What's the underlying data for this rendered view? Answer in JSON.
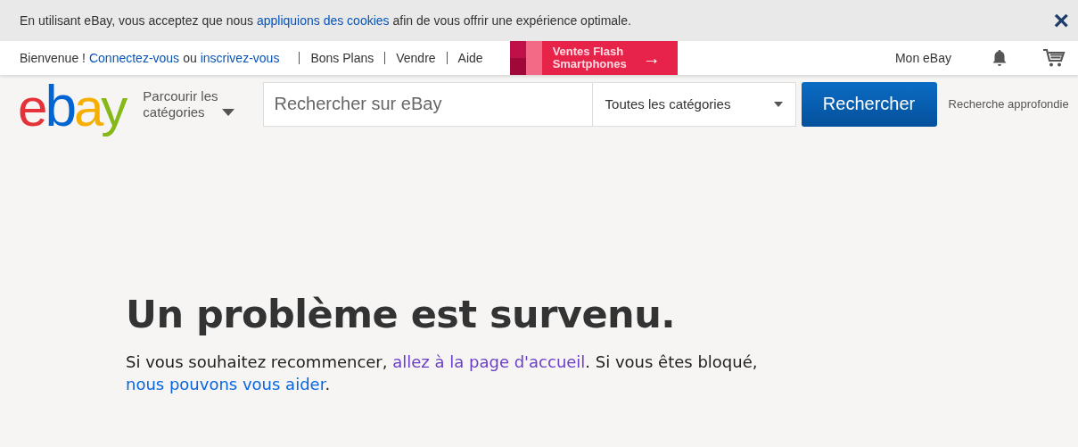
{
  "cookie_banner": {
    "text_before": "En utilisant eBay, vous acceptez que nous",
    "link": "appliquions des cookies",
    "text_after": "afin de vous offrir une expérience optimale.",
    "close": "×"
  },
  "top_nav": {
    "greeting": "Bienvenue !",
    "sign_in": "Connectez-vous",
    "or": "ou",
    "register": "inscrivez-vous",
    "links": [
      {
        "label": "Bons Plans"
      },
      {
        "label": "Vendre"
      },
      {
        "label": "Aide"
      }
    ],
    "promo": {
      "line1": "Ventes Flash",
      "line2": "Smartphones",
      "arrow": "→"
    },
    "my_ebay": "Mon eBay"
  },
  "header": {
    "logo": [
      {
        "letter": "e",
        "color": "#e53238"
      },
      {
        "letter": "b",
        "color": "#0064d2"
      },
      {
        "letter": "a",
        "color": "#f5af02"
      },
      {
        "letter": "y",
        "color": "#86b817"
      }
    ],
    "browse": {
      "line1": "Parcourir les",
      "line2": "catégories"
    },
    "search": {
      "placeholder": "Rechercher sur eBay"
    },
    "category": "Toutes les catégories",
    "search_button": "Rechercher",
    "advanced": "Recherche approfondie"
  },
  "error": {
    "title": "Un problème est survenu.",
    "before": "Si vous souhaitez recommencer,",
    "home_link": "allez à la page d'accueil",
    "middle": ". Si vous êtes bloqué,",
    "help_link": "nous pouvons vous aider",
    "end": "."
  }
}
